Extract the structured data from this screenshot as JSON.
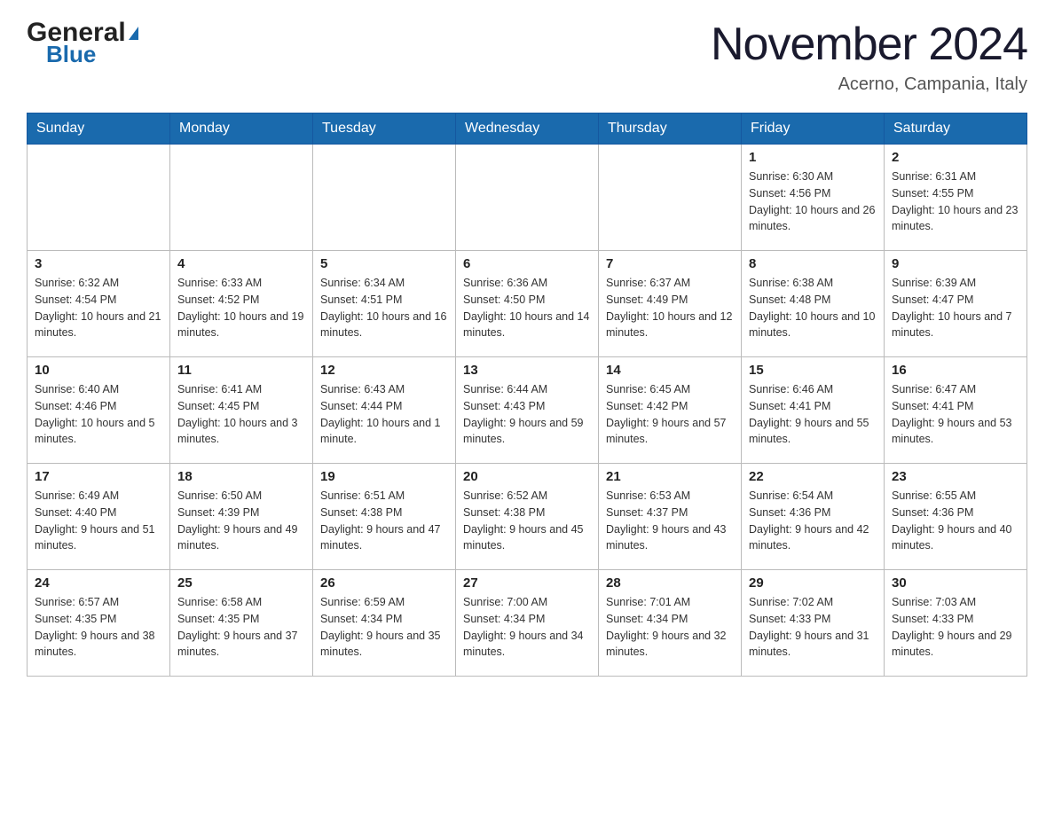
{
  "header": {
    "logo_general": "General",
    "logo_blue": "Blue",
    "month_title": "November 2024",
    "location": "Acerno, Campania, Italy"
  },
  "calendar": {
    "weekdays": [
      "Sunday",
      "Monday",
      "Tuesday",
      "Wednesday",
      "Thursday",
      "Friday",
      "Saturday"
    ],
    "weeks": [
      [
        {
          "day": "",
          "info": ""
        },
        {
          "day": "",
          "info": ""
        },
        {
          "day": "",
          "info": ""
        },
        {
          "day": "",
          "info": ""
        },
        {
          "day": "",
          "info": ""
        },
        {
          "day": "1",
          "info": "Sunrise: 6:30 AM\nSunset: 4:56 PM\nDaylight: 10 hours and 26 minutes."
        },
        {
          "day": "2",
          "info": "Sunrise: 6:31 AM\nSunset: 4:55 PM\nDaylight: 10 hours and 23 minutes."
        }
      ],
      [
        {
          "day": "3",
          "info": "Sunrise: 6:32 AM\nSunset: 4:54 PM\nDaylight: 10 hours and 21 minutes."
        },
        {
          "day": "4",
          "info": "Sunrise: 6:33 AM\nSunset: 4:52 PM\nDaylight: 10 hours and 19 minutes."
        },
        {
          "day": "5",
          "info": "Sunrise: 6:34 AM\nSunset: 4:51 PM\nDaylight: 10 hours and 16 minutes."
        },
        {
          "day": "6",
          "info": "Sunrise: 6:36 AM\nSunset: 4:50 PM\nDaylight: 10 hours and 14 minutes."
        },
        {
          "day": "7",
          "info": "Sunrise: 6:37 AM\nSunset: 4:49 PM\nDaylight: 10 hours and 12 minutes."
        },
        {
          "day": "8",
          "info": "Sunrise: 6:38 AM\nSunset: 4:48 PM\nDaylight: 10 hours and 10 minutes."
        },
        {
          "day": "9",
          "info": "Sunrise: 6:39 AM\nSunset: 4:47 PM\nDaylight: 10 hours and 7 minutes."
        }
      ],
      [
        {
          "day": "10",
          "info": "Sunrise: 6:40 AM\nSunset: 4:46 PM\nDaylight: 10 hours and 5 minutes."
        },
        {
          "day": "11",
          "info": "Sunrise: 6:41 AM\nSunset: 4:45 PM\nDaylight: 10 hours and 3 minutes."
        },
        {
          "day": "12",
          "info": "Sunrise: 6:43 AM\nSunset: 4:44 PM\nDaylight: 10 hours and 1 minute."
        },
        {
          "day": "13",
          "info": "Sunrise: 6:44 AM\nSunset: 4:43 PM\nDaylight: 9 hours and 59 minutes."
        },
        {
          "day": "14",
          "info": "Sunrise: 6:45 AM\nSunset: 4:42 PM\nDaylight: 9 hours and 57 minutes."
        },
        {
          "day": "15",
          "info": "Sunrise: 6:46 AM\nSunset: 4:41 PM\nDaylight: 9 hours and 55 minutes."
        },
        {
          "day": "16",
          "info": "Sunrise: 6:47 AM\nSunset: 4:41 PM\nDaylight: 9 hours and 53 minutes."
        }
      ],
      [
        {
          "day": "17",
          "info": "Sunrise: 6:49 AM\nSunset: 4:40 PM\nDaylight: 9 hours and 51 minutes."
        },
        {
          "day": "18",
          "info": "Sunrise: 6:50 AM\nSunset: 4:39 PM\nDaylight: 9 hours and 49 minutes."
        },
        {
          "day": "19",
          "info": "Sunrise: 6:51 AM\nSunset: 4:38 PM\nDaylight: 9 hours and 47 minutes."
        },
        {
          "day": "20",
          "info": "Sunrise: 6:52 AM\nSunset: 4:38 PM\nDaylight: 9 hours and 45 minutes."
        },
        {
          "day": "21",
          "info": "Sunrise: 6:53 AM\nSunset: 4:37 PM\nDaylight: 9 hours and 43 minutes."
        },
        {
          "day": "22",
          "info": "Sunrise: 6:54 AM\nSunset: 4:36 PM\nDaylight: 9 hours and 42 minutes."
        },
        {
          "day": "23",
          "info": "Sunrise: 6:55 AM\nSunset: 4:36 PM\nDaylight: 9 hours and 40 minutes."
        }
      ],
      [
        {
          "day": "24",
          "info": "Sunrise: 6:57 AM\nSunset: 4:35 PM\nDaylight: 9 hours and 38 minutes."
        },
        {
          "day": "25",
          "info": "Sunrise: 6:58 AM\nSunset: 4:35 PM\nDaylight: 9 hours and 37 minutes."
        },
        {
          "day": "26",
          "info": "Sunrise: 6:59 AM\nSunset: 4:34 PM\nDaylight: 9 hours and 35 minutes."
        },
        {
          "day": "27",
          "info": "Sunrise: 7:00 AM\nSunset: 4:34 PM\nDaylight: 9 hours and 34 minutes."
        },
        {
          "day": "28",
          "info": "Sunrise: 7:01 AM\nSunset: 4:34 PM\nDaylight: 9 hours and 32 minutes."
        },
        {
          "day": "29",
          "info": "Sunrise: 7:02 AM\nSunset: 4:33 PM\nDaylight: 9 hours and 31 minutes."
        },
        {
          "day": "30",
          "info": "Sunrise: 7:03 AM\nSunset: 4:33 PM\nDaylight: 9 hours and 29 minutes."
        }
      ]
    ]
  }
}
